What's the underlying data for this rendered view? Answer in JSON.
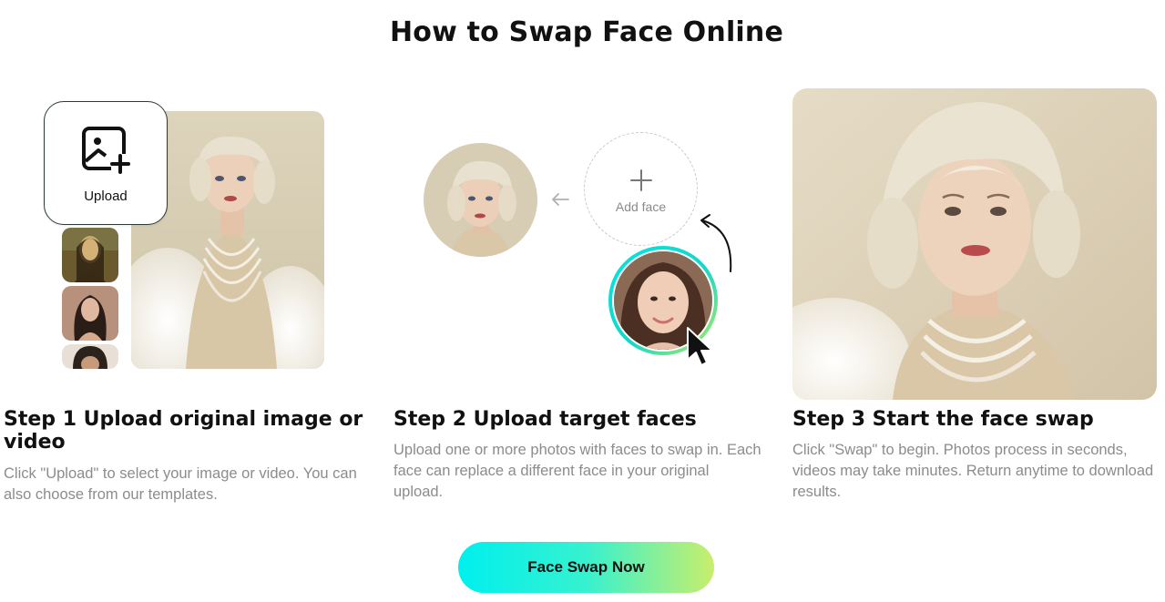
{
  "page": {
    "title": "How to Swap Face Online"
  },
  "step1": {
    "upload_label": "Upload",
    "title": "Step 1 Upload original image or video",
    "description": "Click \"Upload\" to select your image or video. You can also choose from our templates."
  },
  "step2": {
    "add_face_label": "Add face",
    "title": "Step 2 Upload target faces",
    "description": "Upload one or more photos with faces to swap in. Each face can replace a different face in your original upload."
  },
  "step3": {
    "title": "Step 3 Start the face swap",
    "description": "Click \"Swap\" to begin. Photos process in seconds, videos may take minutes. Return anytime to download results."
  },
  "cta": {
    "label": "Face Swap Now"
  },
  "colors": {
    "cta_gradient_start": "#00f0ee",
    "cta_gradient_end": "#c9ee6c",
    "description_text": "#8c8c8c"
  }
}
